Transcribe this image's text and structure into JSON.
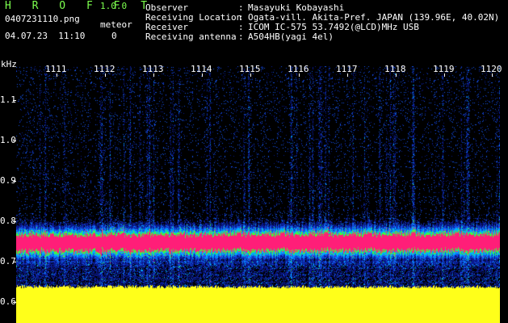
{
  "header": {
    "app_title": "H R O F F T",
    "app_version": "1.0.0",
    "filename": "0407231110.png",
    "datetime": "04.07.23  11:10",
    "meteor_label": "meteor",
    "meteor_count": "0"
  },
  "station": {
    "observer_label": "Observer",
    "observer_value": "Masayuki Kobayashi",
    "location_label": "Receiving Location",
    "location_value": "Ogata-vill. Akita-Pref. JAPAN (139.96E, 40.02N)",
    "receiver_label": "Receiver",
    "receiver_value": "ICOM IC-575 53.7492(@LCD)MHz USB",
    "antenna_label": "Receiving antenna",
    "antenna_value": "A504HB(yagi 4el)",
    "separator": ":"
  },
  "spectrogram": {
    "y_unit": "kHz",
    "y_ticks": [
      "1.1",
      "1.0",
      "0.9",
      "0.8",
      "0.7",
      "0.6"
    ],
    "x_ticks": [
      "1111",
      "1112",
      "1113",
      "1114",
      "1115",
      "1116",
      "1117",
      "1118",
      "1119",
      "1120"
    ],
    "colors": {
      "background": "#000000",
      "noise": "#0a1a8a",
      "band_outer": "#00a0ff",
      "band_mid": "#40ff40",
      "band_core": "#ff1a7a",
      "floor": "#ffff1a"
    }
  }
}
